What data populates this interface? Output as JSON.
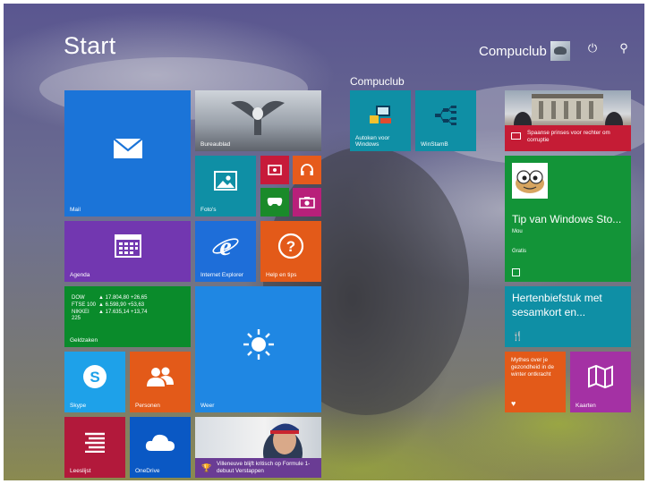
{
  "header": {
    "title": "Start",
    "user_name": "Compuclub",
    "power_icon": "power-icon",
    "search_icon": "search-icon"
  },
  "groups": {
    "compuclub_label": "Compuclub"
  },
  "tiles": {
    "mail": "Mail",
    "desktop": "Bureaublad",
    "photos": "Foto's",
    "agenda": "Agenda",
    "ie": "Internet Explorer",
    "help": "Help en tips",
    "finance": {
      "label": "Geldzaken",
      "rows": [
        {
          "name": "DOW",
          "value": "▲ 17.804,80 +26,65"
        },
        {
          "name": "FTSE 100",
          "value": "▲ 6.598,90 +53,63"
        },
        {
          "name": "NIKKEI 225",
          "value": "▲ 17.635,14 +13,74"
        }
      ]
    },
    "weather": "Weer",
    "skype": "Skype",
    "people": "Personen",
    "reading": "Leeslijst",
    "onedrive": "OneDrive",
    "sport": "Villeneuve blijft kritisch op Formule 1-debuut Verstappen",
    "autoken": "Autoken voor Windows",
    "winstam": "WinStamB",
    "news": "Spaanse prinses voor rechter om corruptie",
    "store": {
      "title": "Tip van Windows Sto...",
      "sub1": "Mou",
      "sub2": "Gratis"
    },
    "food": "Hertenbiefstuk met sesamkort en...",
    "health": "Mythes over je gezondheid in de winter ontkracht",
    "maps": "Kaarten"
  },
  "colors": {
    "mail": "#1b74d8",
    "agenda": "#7237b0",
    "finance": "#0a8b2b",
    "store": "#139438",
    "accent": "#0f8fa5"
  }
}
